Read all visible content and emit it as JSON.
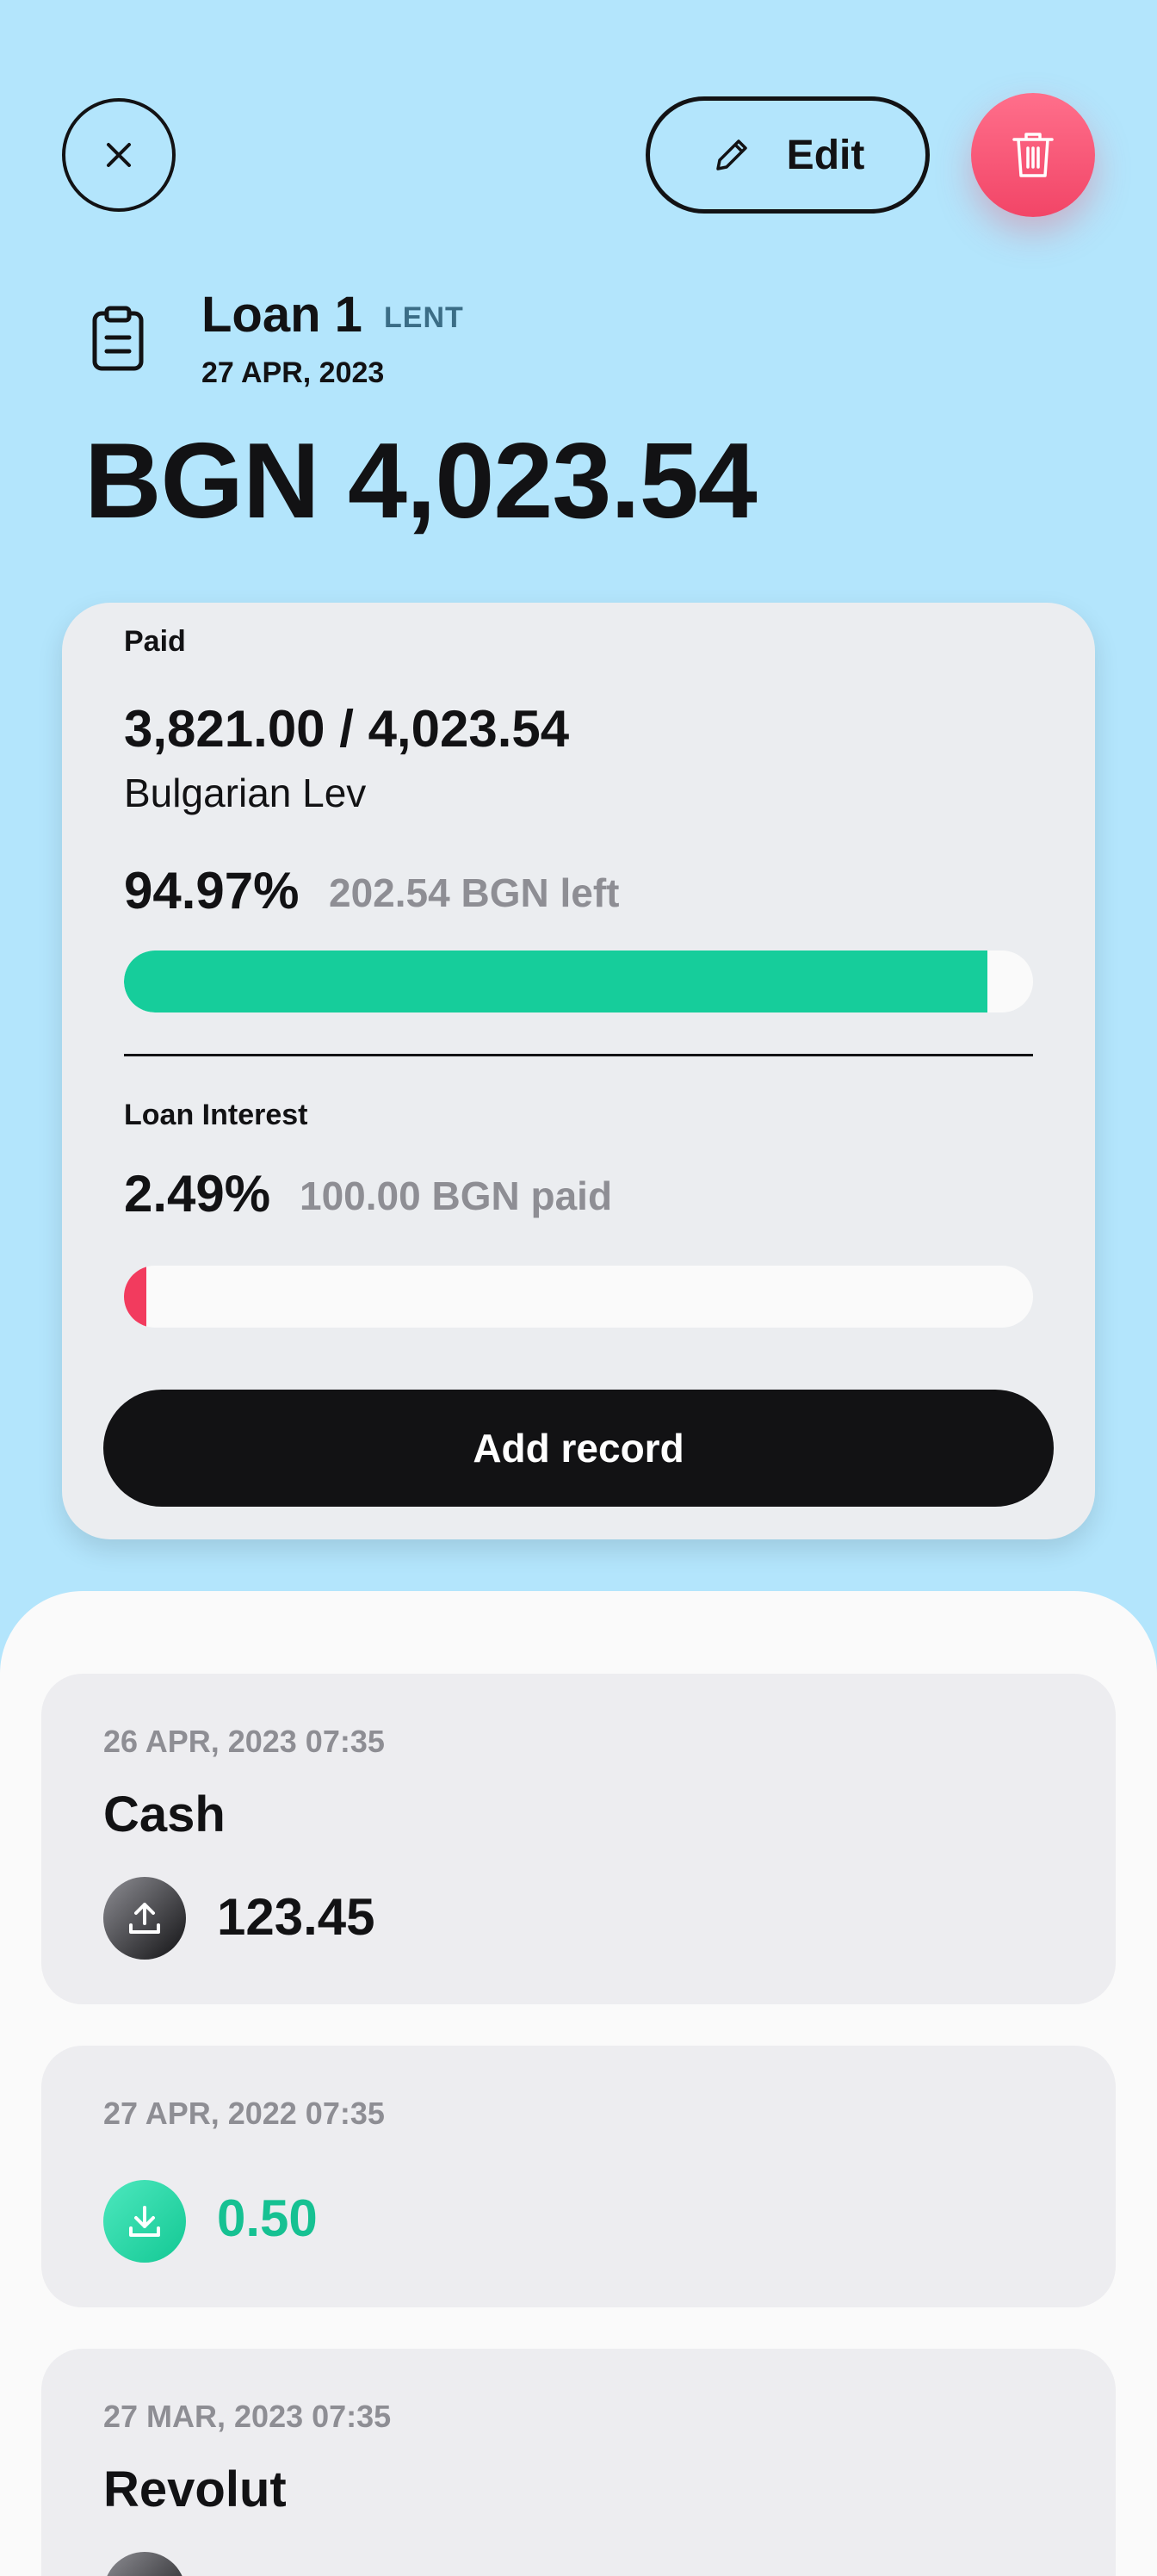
{
  "header": {
    "edit_label": "Edit",
    "loan_name": "Loan 1",
    "loan_type": "LENT",
    "date": "27 APR, 2023",
    "amount": "BGN 4,023.54"
  },
  "summary": {
    "paid_label": "Paid",
    "paid_values": "3,821.00 / 4,023.54",
    "currency_name": "Bulgarian Lev",
    "paid_percent": "94.97%",
    "paid_left": "202.54 BGN left",
    "paid_progress": 0.9497,
    "interest_label": "Loan Interest",
    "interest_percent": "2.49%",
    "interest_paid": "100.00 BGN paid",
    "interest_progress": 0.0249,
    "add_record_label": "Add record"
  },
  "records": [
    {
      "date": "26 APR, 2023 07:35",
      "name": "Cash",
      "value": "123.45",
      "direction": "outgoing",
      "icon": "upload-icon"
    },
    {
      "date": "27 APR, 2022 07:35",
      "name": "",
      "value": "0.50",
      "direction": "incoming",
      "icon": "download-icon"
    },
    {
      "date": "27 MAR, 2023 07:35",
      "name": "Revolut",
      "value": "",
      "direction": "outgoing",
      "icon": "upload-icon"
    }
  ],
  "colors": {
    "background": "#b3e5fc",
    "paid_bar": "#16cd9b",
    "interest_bar": "#f23b5e",
    "delete_button": "#f24567",
    "incoming_value": "#16c192"
  }
}
